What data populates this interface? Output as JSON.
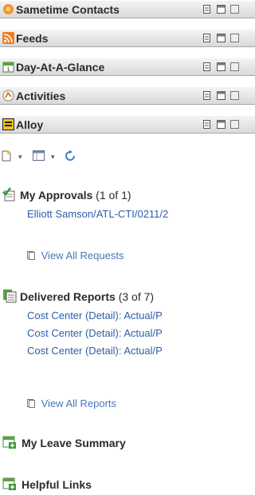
{
  "bars": [
    {
      "label": "Sametime Contacts",
      "icon": "sametime-icon"
    },
    {
      "label": "Feeds",
      "icon": "rss-feed-icon"
    },
    {
      "label": "Day-At-A-Glance",
      "icon": "calendar-icon"
    },
    {
      "label": "Activities",
      "icon": "activities-icon"
    },
    {
      "label": "Alloy",
      "icon": "alloy-icon"
    }
  ],
  "toolbar": {
    "new_icon": "new-document-icon",
    "view_icon": "view-layout-icon",
    "refresh_icon": "refresh-icon"
  },
  "approvals": {
    "title": "My Approvals",
    "count": "(1 of 1)",
    "items": [
      "Elliott Samson/ATL-CTI/0211/2"
    ],
    "view_all": "View All Requests"
  },
  "reports": {
    "title": "Delivered Reports",
    "count": "(3 of 7)",
    "items": [
      "Cost Center (Detail): Actual/P",
      "Cost Center (Detail): Actual/P",
      "Cost Center (Detail): Actual/P"
    ],
    "view_all": "View All Reports"
  },
  "leave": {
    "title": "My Leave Summary"
  },
  "links": {
    "title": "Helpful Links"
  },
  "colors": {
    "link": "#2e5fa8",
    "bar_top": "#f4f4f4",
    "bar_bottom": "#d9d9d9"
  }
}
